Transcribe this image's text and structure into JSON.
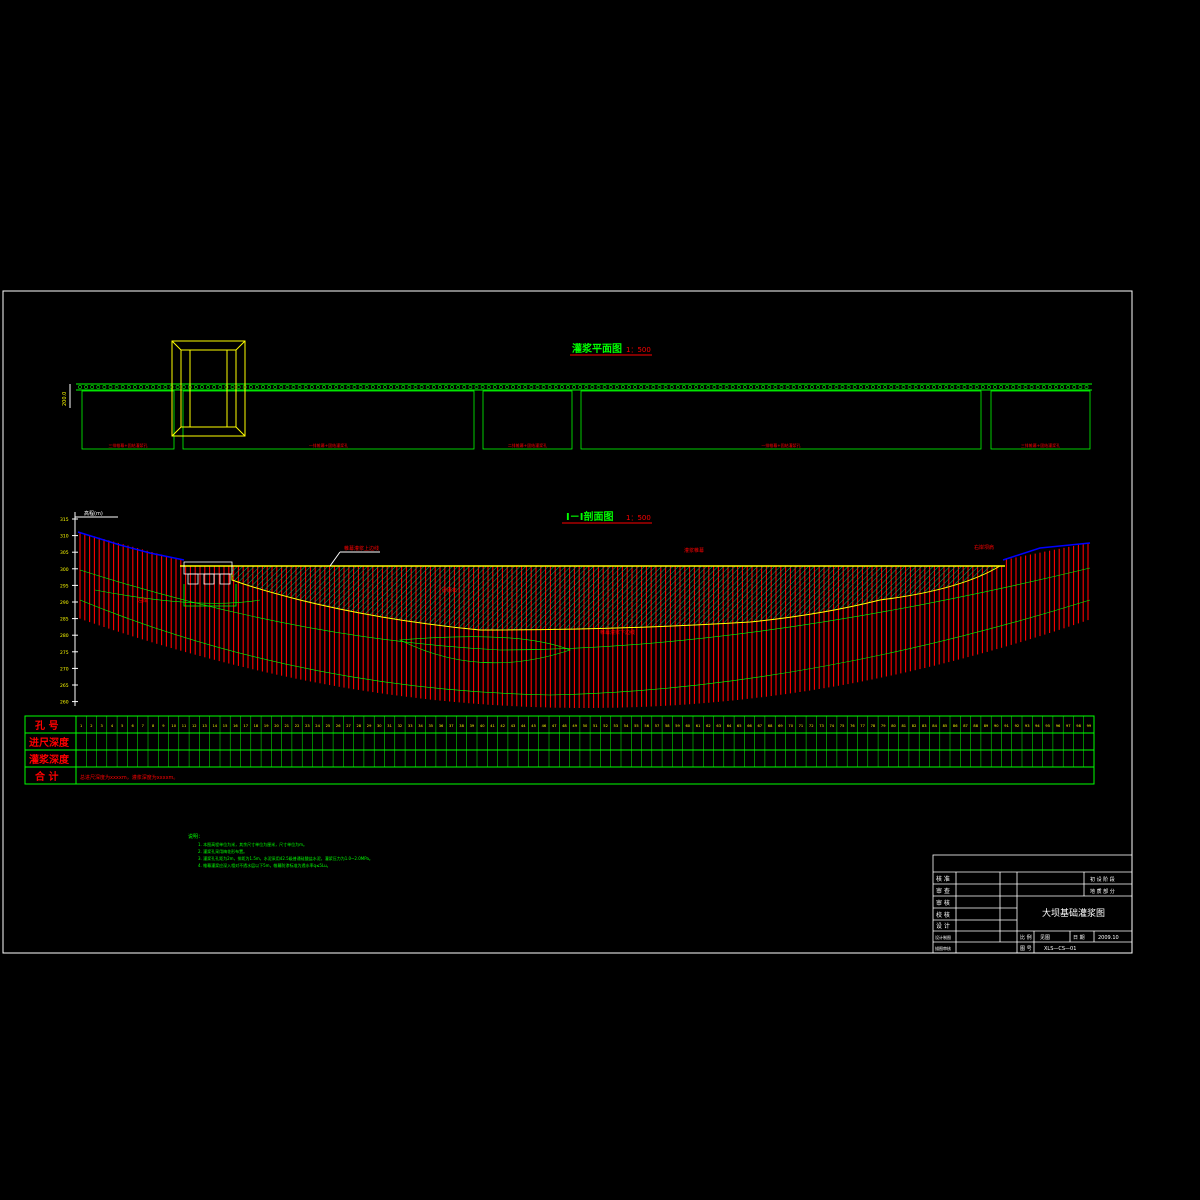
{
  "plan": {
    "title": "灌浆平面图",
    "scale": "1：500",
    "elev_label": "200.0",
    "zone_labels": [
      "三排帷幕+固结灌浆孔",
      "一排帷幕+固结灌浆孔",
      "二排帷幕+固结灌浆孔",
      "一排帷幕+固结灌浆孔",
      "三排帷幕+固结灌浆孔"
    ]
  },
  "section": {
    "title": "Ⅰ－Ⅰ剖面图",
    "scale": "1：500",
    "elev_ticks": [
      "315",
      "310",
      "305",
      "300",
      "295",
      "290",
      "285",
      "280",
      "275",
      "270",
      "265",
      "260"
    ],
    "axis_label": "高程(m)",
    "annotations": {
      "dam_top": "帷幕灌浆上边线",
      "grout_curtain": "灌浆帷幕",
      "core": "砂砾石",
      "bottom": "帷幕灌浆下边线",
      "right_bank": "右岸坝肩",
      "left_label": "左岸"
    }
  },
  "table": {
    "row_labels": [
      "孔 号",
      "进尺深度",
      "灌浆深度",
      "合 计"
    ],
    "hole_count": 99,
    "total_note": "总进尺深度为xxxxm，灌浆深度为xxxxm。"
  },
  "notes": {
    "heading": "说明：",
    "items": [
      "1. 本图高程单位为米，其余尺寸单位为厘米，尺寸单位为m。",
      "2. 灌浆孔采用梅花形布置。",
      "3. 灌浆孔孔距为2m，排距为1.5m，水泥采用42.5级普通硅酸盐水泥，灌浆压力为1.0~2.0MPa。",
      "4. 帷幕灌浆应深入相对不透水层以下5m，帷幕防渗标准为透水率q≤5Lu。"
    ]
  },
  "title_block": {
    "left_rows": [
      "核 准",
      "审 查",
      "审 核",
      "校 核",
      "设 计",
      "设计制图",
      "描图审核"
    ],
    "stage_label": "初 设 阶 段",
    "part_label": "地 质 部 分",
    "drawing_title": "大坝基础灌浆图",
    "scale_label": "比 例",
    "scale_value": "见图",
    "date_label": "日 期",
    "date_value": "2009.10",
    "no_label": "图 号",
    "no_value": "XLS—CS—01"
  },
  "colors": {
    "frame": "#ffffff",
    "plan_lines": "#00ff00",
    "plan_structure": "#ffff00",
    "grout_lines": "#ff0000",
    "ground_profile": "#0000ff",
    "hatch": "#00aa66",
    "text_red": "#ff0000",
    "text_green": "#00ff00",
    "table_lines": "#00ff00",
    "table_labels": "#ff0000",
    "table_cells": "#ffff00"
  }
}
